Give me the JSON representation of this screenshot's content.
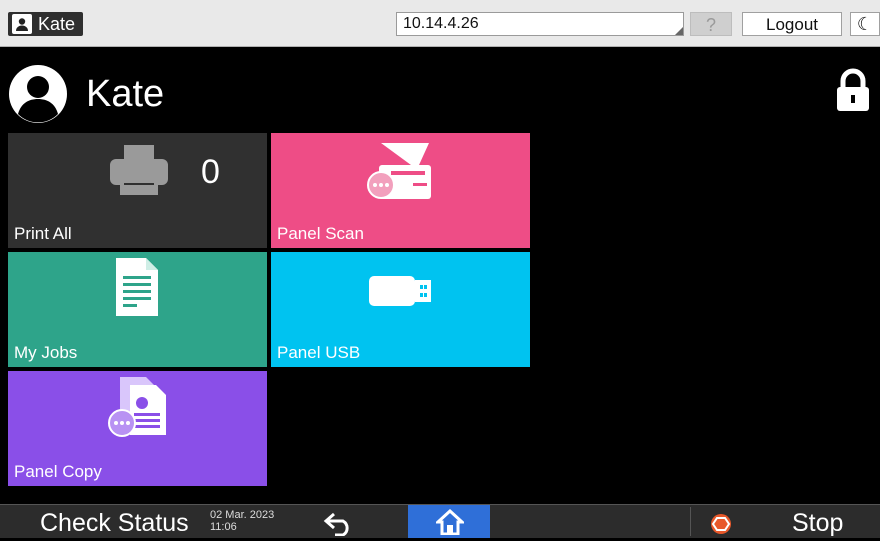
{
  "topbar": {
    "user_name": "Kate",
    "ip_address": "10.14.4.26",
    "help_label": "?",
    "logout_label": "Logout",
    "sleep_label": "☾"
  },
  "header": {
    "user_name": "Kate"
  },
  "tiles": [
    {
      "id": "print-all",
      "label": "Print All",
      "count": "0",
      "color": "#303030"
    },
    {
      "id": "panel-scan",
      "label": "Panel Scan",
      "color": "#ee4d86"
    },
    {
      "id": "my-jobs",
      "label": "My Jobs",
      "color": "#2ea48a"
    },
    {
      "id": "panel-usb",
      "label": "Panel USB",
      "color": "#00c3f0"
    },
    {
      "id": "panel-copy",
      "label": "Panel Copy",
      "color": "#8a4fe8"
    }
  ],
  "bottombar": {
    "check_status_label": "Check Status",
    "date": "02 Mar. 2023",
    "time": "11:06",
    "stop_label": "Stop",
    "home_color": "#2f6fd8"
  }
}
